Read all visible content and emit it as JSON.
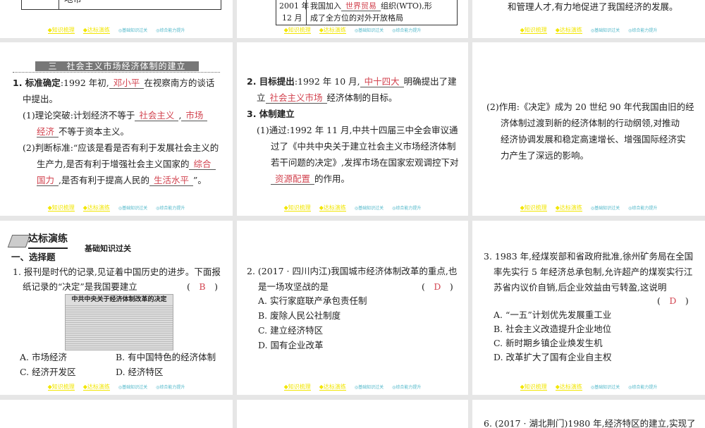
{
  "footer": {
    "items": [
      "◆知识梳理",
      "◆达标演练",
      "◎基础知识过关",
      "◎综合能力提升"
    ]
  },
  "p1": {
    "cell": "地带"
  },
  "p2": {
    "year": "2001 年",
    "month": "12 月",
    "l1a": "我国加入",
    "l1ans": "世界贸易",
    "l1b": "组织(WTO),形",
    "l2": "成了全方位的对外开放格局"
  },
  "p3": {
    "line": "和管理人才,有力地促进了我国经济的发展。"
  },
  "p4": {
    "heading": "三　社会主义市场经济体制的建立",
    "q1label": "1. 标准确定",
    "q1a": ":1992 年初,",
    "q1ans": "邓小平",
    "q1b": "在视察南方的谈话",
    "q1c": "中提出。",
    "s1a": "(1)理论突破:计划经济不等于",
    "s1ans1": "社会主义",
    "s1b": ",",
    "s1ans2a": "市场",
    "s1ans2b": "经济",
    "s1c": "不等于资本主义。",
    "s2a": "(2)判断标准:“应该是看是否有利于发展社会主义的",
    "s2b": "生产力,是否有利于增强社会主义国家的",
    "s2ans1a": "综合",
    "s2ans1b": "国力",
    "s2c": ",是否有利于提高人民的",
    "s2ans2": "生活水平",
    "s2d": "”。"
  },
  "p5": {
    "q2label": "2. 目标提出",
    "q2a": ":1992 年 10 月,",
    "q2ans": "中十四大",
    "q2b": "明确提出了建",
    "q2c": "立",
    "q2ans2": "社会主义市场",
    "q2d": "经济体制的目标。",
    "q3label": "3. 体制建立",
    "l1": "(1)通过:1992 年 11 月,中共十四届三中全会审议通",
    "l2": "过了《中共中央关于建立社会主义市场经济体制",
    "l3": "若干问题的决定》,发挥市场在国家宏观调控下对",
    "ans": "资源配置",
    "l4": "的作用。"
  },
  "p6": {
    "l1": "(2)作用:《决定》成为 20 世纪 90 年代我国由旧的经",
    "l2": "济体制过渡到新的经济体制的行动纲领,对推动",
    "l3": "经济协调发展和稳定高速增长、增强国际经济实",
    "l4": "力产生了深远的影响。"
  },
  "p7": {
    "title": "达标演练",
    "subtitle": "基础知识过关",
    "section": "一、选择题",
    "q1": "1. 报刊是时代的记录,见证着中国历史的进步。下面报",
    "q2": "纸记录的“决定”是我国要建立",
    "answer": "B",
    "newspaper": "中共中央关于经济体制改革的决定",
    "opts": [
      "A. 市场经济",
      "B. 有中国特色的经济体制",
      "C. 经济开发区",
      "D. 经济特区"
    ]
  },
  "p8": {
    "q1": "2. (2017 · 四川内江)我国城市经济体制改革的重点,也",
    "q2": "是一场攻坚战的是",
    "answer": "D",
    "opts": [
      "A. 实行家庭联产承包责任制",
      "B. 废除人民公社制度",
      "C. 建立经济特区",
      "D. 国有企业改革"
    ]
  },
  "p9": {
    "q1": "3. 1983 年,经煤炭部和省政府批准,徐州矿务局在全国",
    "q2": "率先实行 5 年经济总承包制,允许超产的煤炭实行江",
    "q3": "苏省内议价自销,后企业效益由亏转盈,这说明",
    "answer": "D",
    "opts": [
      "A. “一五”计划优先发展重工业",
      "B. 社会主义改造提升企业地位",
      "C. 新时期乡镇企业焕发生机",
      "D. 改革扩大了国有企业自主权"
    ]
  },
  "p12": {
    "q1": "6. (2017 · 湖北荆门)1980 年,经济特区的建立,实现了"
  }
}
